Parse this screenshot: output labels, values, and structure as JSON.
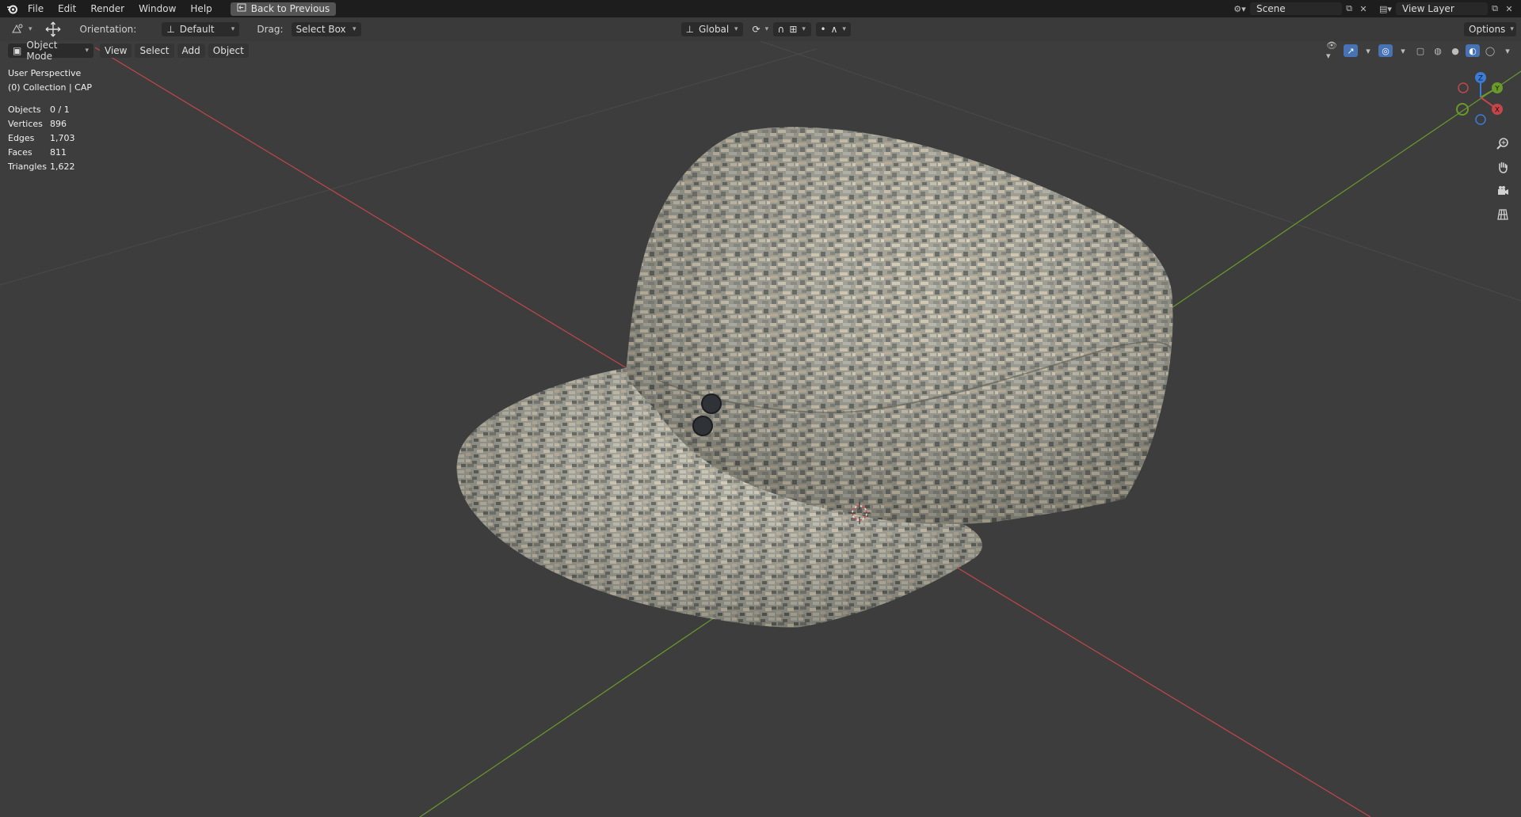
{
  "menubar": {
    "items": [
      "File",
      "Edit",
      "Render",
      "Window",
      "Help"
    ],
    "back_button": "Back to Previous",
    "scene": "Scene",
    "view_layer": "View Layer"
  },
  "toolbar": {
    "orientation_label": "Orientation:",
    "orientation_value": "Default",
    "drag_label": "Drag:",
    "drag_value": "Select Box",
    "transform_orientation": "Global",
    "options_label": "Options"
  },
  "header": {
    "mode": "Object Mode",
    "menus": [
      "View",
      "Select",
      "Add",
      "Object"
    ]
  },
  "viewport": {
    "perspective": "User Perspective",
    "collection": "(0) Collection | CAP",
    "stats": [
      {
        "label": "Objects",
        "value": "0 / 1"
      },
      {
        "label": "Vertices",
        "value": "896"
      },
      {
        "label": "Edges",
        "value": "1,703"
      },
      {
        "label": "Faces",
        "value": "811"
      },
      {
        "label": "Triangles",
        "value": "1,622"
      }
    ]
  },
  "gizmo": {
    "z": "Z",
    "y": "Y",
    "x": "X"
  },
  "colors": {
    "x_axis": "#c4464a",
    "y_axis": "#6a9a2a",
    "z_axis": "#3c7bd6",
    "bg": "#3d3d3d"
  }
}
